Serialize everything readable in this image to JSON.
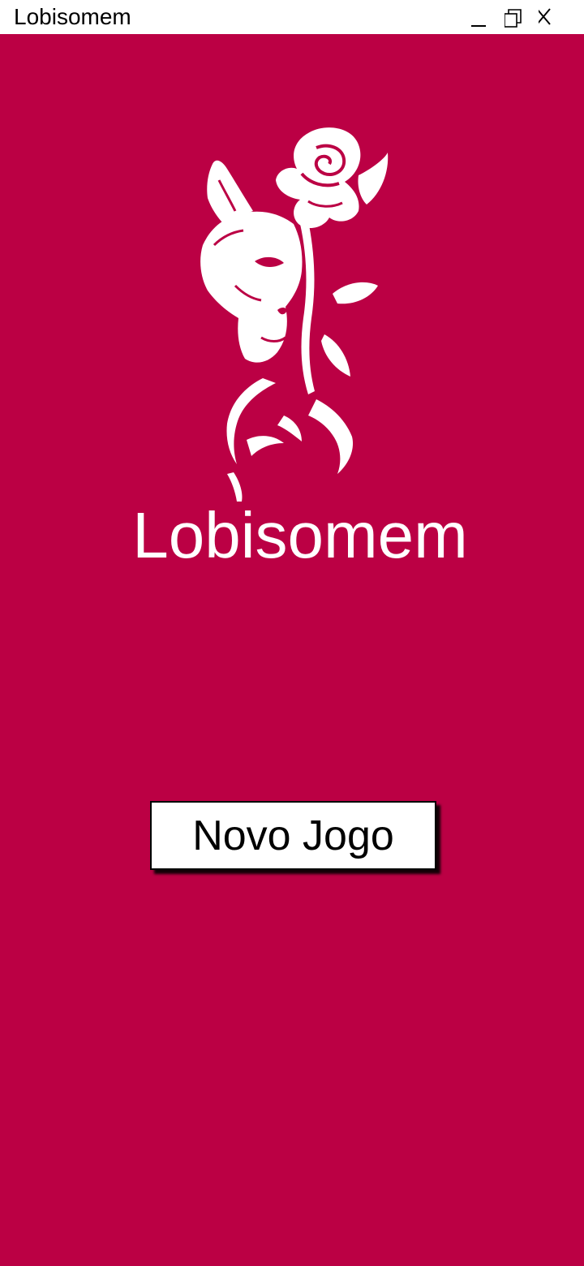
{
  "window": {
    "title": "Lobisomem",
    "controls": {
      "minimize_icon": "minimize-icon",
      "maximize_icon": "restore-icon",
      "close_icon": "close-icon"
    }
  },
  "main": {
    "background_color": "#bb0044",
    "logo_icon": "wolf-rose-logo-icon",
    "app_title": "Lobisomem",
    "new_game_label": "Novo Jogo"
  }
}
